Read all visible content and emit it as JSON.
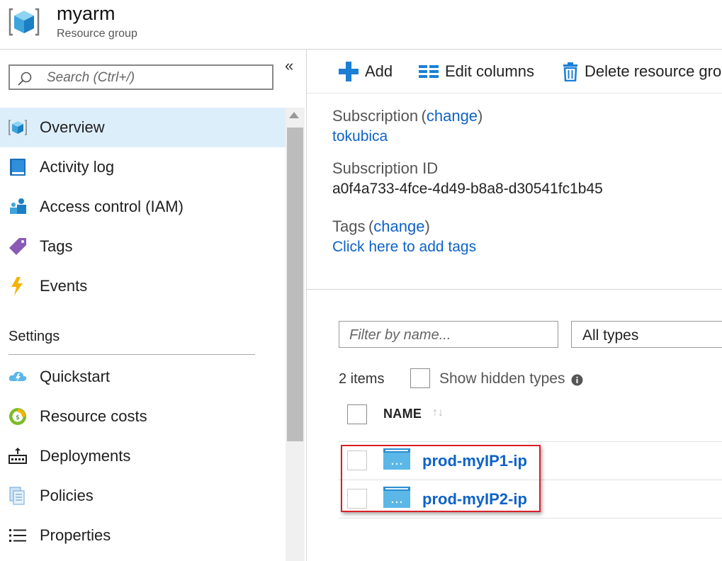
{
  "header": {
    "title": "myarm",
    "subtitle": "Resource group"
  },
  "sidebar": {
    "search_placeholder": "Search (Ctrl+/)",
    "collapse_glyph": "«",
    "items": [
      {
        "label": "Overview",
        "icon": "cube-icon",
        "active": true
      },
      {
        "label": "Activity log",
        "icon": "book-icon"
      },
      {
        "label": "Access control (IAM)",
        "icon": "people-icon"
      },
      {
        "label": "Tags",
        "icon": "tag-icon"
      },
      {
        "label": "Events",
        "icon": "lightning-icon"
      }
    ],
    "settings_heading": "Settings",
    "settings_items": [
      {
        "label": "Quickstart",
        "icon": "cloud-icon"
      },
      {
        "label": "Resource costs",
        "icon": "cost-icon"
      },
      {
        "label": "Deployments",
        "icon": "deployments-icon"
      },
      {
        "label": "Policies",
        "icon": "policies-icon"
      },
      {
        "label": "Properties",
        "icon": "list-icon"
      }
    ]
  },
  "toolbar": {
    "add_label": "Add",
    "edit_columns_label": "Edit columns",
    "delete_label": "Delete resource gro"
  },
  "essentials": {
    "subscription_label": "Subscription",
    "paren_open": "(",
    "paren_close": ")",
    "change_link": "change",
    "subscription_value": "tokubica",
    "subscription_id_label": "Subscription ID",
    "subscription_id_value": "a0f4a733-4fce-4d49-b8a8-d30541fc1b45",
    "tags_label": "Tags",
    "tags_link": "Click here to add tags"
  },
  "filter": {
    "name_placeholder": "Filter by name...",
    "types_value": "All types"
  },
  "list": {
    "items_count": "2 items",
    "show_hidden_label": "Show hidden types",
    "name_column": "NAME",
    "sort_glyph": "↑↓",
    "rows": [
      {
        "name": "prod-myIP1-ip"
      },
      {
        "name": "prod-myIP2-ip"
      }
    ]
  },
  "colors": {
    "accent": "#0e62c8",
    "active_bg": "#ddeefb",
    "highlight": "#d9202a"
  }
}
